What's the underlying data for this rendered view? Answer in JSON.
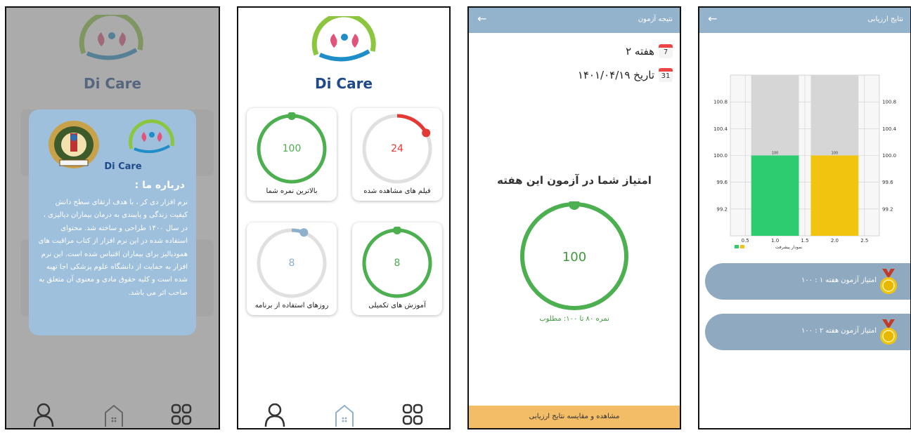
{
  "app": {
    "logo_text": "Di Care"
  },
  "colors": {
    "green": "#4caf50",
    "red": "#e53935",
    "track": "#e0e0e0",
    "blue": "#8fb0cc",
    "header": "#93b2cc",
    "cta": "#f3bd68",
    "bar_green": "#2ecc71",
    "bar_yellow": "#f1c40f"
  },
  "about": {
    "title": "درباره ما :",
    "body": "نرم افزار دی کر ، با هدف ارتقای سطح دانش کیفیت زندگی و پایبندی به درمان بیماران دیالیزی ، در سال ۱۴۰۰ طراحی و ساخته شد. محتوای استفاده شده در این نرم افزار از کتاب مراقبت های همودیالیز برای بیماران اقتباس شده است. این نرم افزار به حمایت از دانشگاه علوم پزشکی اجا تهیه شده است و کلیه حقوق مادی و معنوی آن متعلق به صاحب اثر می باشد.",
    "seal_icon": "university-seal-icon"
  },
  "dashboard": {
    "cards": [
      {
        "value": "100",
        "label": "بالاترین نمره شما",
        "progress": 1.0,
        "color": "#4caf50"
      },
      {
        "value": "24",
        "label": "فیلم های مشاهده شده",
        "progress": 0.17,
        "color": "#e53935"
      },
      {
        "value": "8",
        "label": "روزهای استفاده از برنامه",
        "progress": 0.06,
        "color": "#8fb0cc"
      },
      {
        "value": "8",
        "label": "آموزش های تکمیلی",
        "progress": 1.0,
        "color": "#4caf50"
      }
    ]
  },
  "nav": {
    "icons": [
      "person-icon",
      "home-icon",
      "grid-icon"
    ]
  },
  "result": {
    "header": "نتیجه آزمون",
    "week": "هفته ۲",
    "date": "تاریخ ۱۴۰۱/۰۴/۱۹",
    "cal_day_1": "7",
    "cal_day_2": "31",
    "score_title": "امتیاز شما در آزمون این هفته",
    "score": "100",
    "required": "نمره ۸۰ تا ۱۰۰: مطلوب",
    "cta": "مشاهده و مقایسه نتایج ارزیابی"
  },
  "evaluation": {
    "header": "نتایج ارزیابی",
    "weeks": [
      {
        "label": "امتیاز آزمون هفته ۱ : ۱۰۰"
      },
      {
        "label": "امتیاز آزمون هفته ۲ : ۱۰۰"
      }
    ]
  },
  "chart_data": {
    "type": "bar",
    "x": [
      1.0,
      2.0
    ],
    "values": [
      100,
      100
    ],
    "data_labels": [
      "100",
      "100"
    ],
    "x_ticks": [
      "0.5",
      "1.0",
      "1.5",
      "2.0",
      "2.5"
    ],
    "y_ticks": [
      "99.2",
      "99.6",
      "100.0",
      "100.4",
      "100.8"
    ],
    "ylim": [
      98.8,
      101.2
    ],
    "xlim": [
      0.25,
      2.75
    ],
    "legend": "نمودار پیشرفت",
    "legend_placement": "bottom-left",
    "grid": true,
    "colors": [
      "#2ecc71",
      "#f1c40f"
    ]
  }
}
